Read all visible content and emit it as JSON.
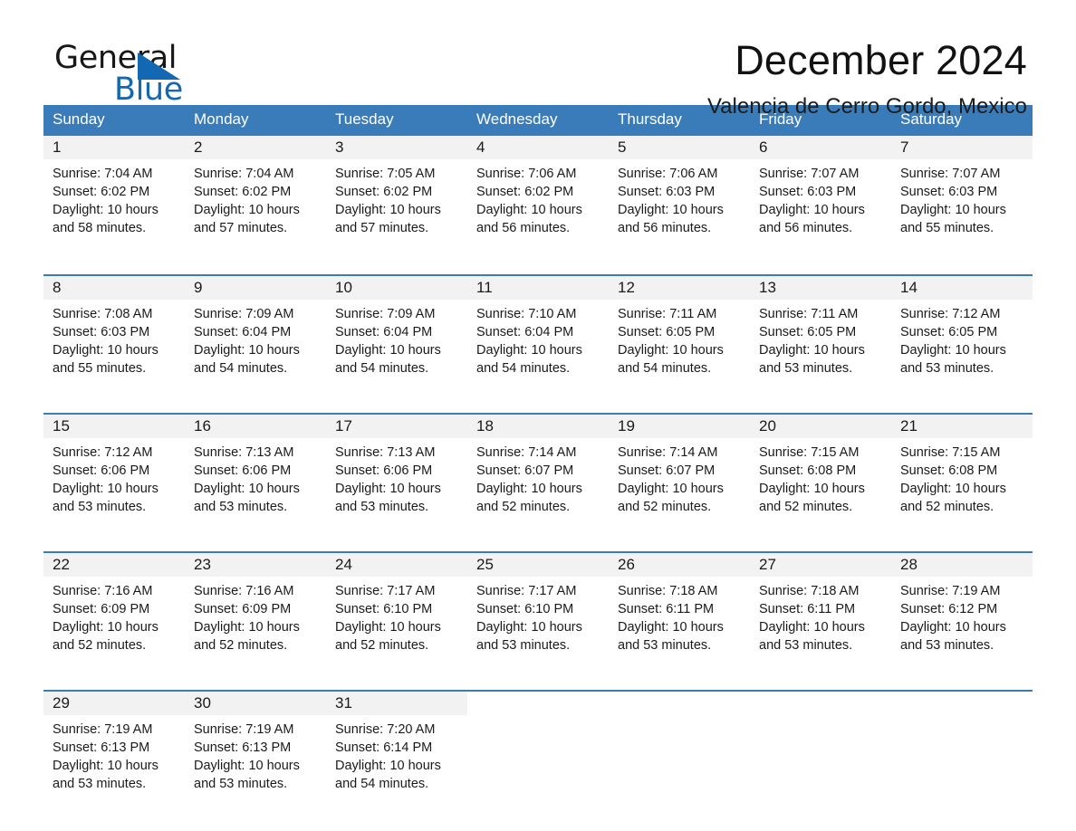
{
  "logo": {
    "word1": "General",
    "word2": "Blue",
    "triangle_color": "#1268b3"
  },
  "header": {
    "month_title": "December 2024",
    "location": "Valencia de Cerro Gordo, Mexico",
    "header_bg_color": "#3a7cba",
    "daynum_bg_color": "#f2f2f2"
  },
  "weekday_headers": [
    "Sunday",
    "Monday",
    "Tuesday",
    "Wednesday",
    "Thursday",
    "Friday",
    "Saturday"
  ],
  "weeks": [
    [
      {
        "day": "1",
        "sunrise": "Sunrise: 7:04 AM",
        "sunset": "Sunset: 6:02 PM",
        "daylight_1": "Daylight: 10 hours",
        "daylight_2": "and 58 minutes."
      },
      {
        "day": "2",
        "sunrise": "Sunrise: 7:04 AM",
        "sunset": "Sunset: 6:02 PM",
        "daylight_1": "Daylight: 10 hours",
        "daylight_2": "and 57 minutes."
      },
      {
        "day": "3",
        "sunrise": "Sunrise: 7:05 AM",
        "sunset": "Sunset: 6:02 PM",
        "daylight_1": "Daylight: 10 hours",
        "daylight_2": "and 57 minutes."
      },
      {
        "day": "4",
        "sunrise": "Sunrise: 7:06 AM",
        "sunset": "Sunset: 6:02 PM",
        "daylight_1": "Daylight: 10 hours",
        "daylight_2": "and 56 minutes."
      },
      {
        "day": "5",
        "sunrise": "Sunrise: 7:06 AM",
        "sunset": "Sunset: 6:03 PM",
        "daylight_1": "Daylight: 10 hours",
        "daylight_2": "and 56 minutes."
      },
      {
        "day": "6",
        "sunrise": "Sunrise: 7:07 AM",
        "sunset": "Sunset: 6:03 PM",
        "daylight_1": "Daylight: 10 hours",
        "daylight_2": "and 56 minutes."
      },
      {
        "day": "7",
        "sunrise": "Sunrise: 7:07 AM",
        "sunset": "Sunset: 6:03 PM",
        "daylight_1": "Daylight: 10 hours",
        "daylight_2": "and 55 minutes."
      }
    ],
    [
      {
        "day": "8",
        "sunrise": "Sunrise: 7:08 AM",
        "sunset": "Sunset: 6:03 PM",
        "daylight_1": "Daylight: 10 hours",
        "daylight_2": "and 55 minutes."
      },
      {
        "day": "9",
        "sunrise": "Sunrise: 7:09 AM",
        "sunset": "Sunset: 6:04 PM",
        "daylight_1": "Daylight: 10 hours",
        "daylight_2": "and 54 minutes."
      },
      {
        "day": "10",
        "sunrise": "Sunrise: 7:09 AM",
        "sunset": "Sunset: 6:04 PM",
        "daylight_1": "Daylight: 10 hours",
        "daylight_2": "and 54 minutes."
      },
      {
        "day": "11",
        "sunrise": "Sunrise: 7:10 AM",
        "sunset": "Sunset: 6:04 PM",
        "daylight_1": "Daylight: 10 hours",
        "daylight_2": "and 54 minutes."
      },
      {
        "day": "12",
        "sunrise": "Sunrise: 7:11 AM",
        "sunset": "Sunset: 6:05 PM",
        "daylight_1": "Daylight: 10 hours",
        "daylight_2": "and 54 minutes."
      },
      {
        "day": "13",
        "sunrise": "Sunrise: 7:11 AM",
        "sunset": "Sunset: 6:05 PM",
        "daylight_1": "Daylight: 10 hours",
        "daylight_2": "and 53 minutes."
      },
      {
        "day": "14",
        "sunrise": "Sunrise: 7:12 AM",
        "sunset": "Sunset: 6:05 PM",
        "daylight_1": "Daylight: 10 hours",
        "daylight_2": "and 53 minutes."
      }
    ],
    [
      {
        "day": "15",
        "sunrise": "Sunrise: 7:12 AM",
        "sunset": "Sunset: 6:06 PM",
        "daylight_1": "Daylight: 10 hours",
        "daylight_2": "and 53 minutes."
      },
      {
        "day": "16",
        "sunrise": "Sunrise: 7:13 AM",
        "sunset": "Sunset: 6:06 PM",
        "daylight_1": "Daylight: 10 hours",
        "daylight_2": "and 53 minutes."
      },
      {
        "day": "17",
        "sunrise": "Sunrise: 7:13 AM",
        "sunset": "Sunset: 6:06 PM",
        "daylight_1": "Daylight: 10 hours",
        "daylight_2": "and 53 minutes."
      },
      {
        "day": "18",
        "sunrise": "Sunrise: 7:14 AM",
        "sunset": "Sunset: 6:07 PM",
        "daylight_1": "Daylight: 10 hours",
        "daylight_2": "and 52 minutes."
      },
      {
        "day": "19",
        "sunrise": "Sunrise: 7:14 AM",
        "sunset": "Sunset: 6:07 PM",
        "daylight_1": "Daylight: 10 hours",
        "daylight_2": "and 52 minutes."
      },
      {
        "day": "20",
        "sunrise": "Sunrise: 7:15 AM",
        "sunset": "Sunset: 6:08 PM",
        "daylight_1": "Daylight: 10 hours",
        "daylight_2": "and 52 minutes."
      },
      {
        "day": "21",
        "sunrise": "Sunrise: 7:15 AM",
        "sunset": "Sunset: 6:08 PM",
        "daylight_1": "Daylight: 10 hours",
        "daylight_2": "and 52 minutes."
      }
    ],
    [
      {
        "day": "22",
        "sunrise": "Sunrise: 7:16 AM",
        "sunset": "Sunset: 6:09 PM",
        "daylight_1": "Daylight: 10 hours",
        "daylight_2": "and 52 minutes."
      },
      {
        "day": "23",
        "sunrise": "Sunrise: 7:16 AM",
        "sunset": "Sunset: 6:09 PM",
        "daylight_1": "Daylight: 10 hours",
        "daylight_2": "and 52 minutes."
      },
      {
        "day": "24",
        "sunrise": "Sunrise: 7:17 AM",
        "sunset": "Sunset: 6:10 PM",
        "daylight_1": "Daylight: 10 hours",
        "daylight_2": "and 52 minutes."
      },
      {
        "day": "25",
        "sunrise": "Sunrise: 7:17 AM",
        "sunset": "Sunset: 6:10 PM",
        "daylight_1": "Daylight: 10 hours",
        "daylight_2": "and 53 minutes."
      },
      {
        "day": "26",
        "sunrise": "Sunrise: 7:18 AM",
        "sunset": "Sunset: 6:11 PM",
        "daylight_1": "Daylight: 10 hours",
        "daylight_2": "and 53 minutes."
      },
      {
        "day": "27",
        "sunrise": "Sunrise: 7:18 AM",
        "sunset": "Sunset: 6:11 PM",
        "daylight_1": "Daylight: 10 hours",
        "daylight_2": "and 53 minutes."
      },
      {
        "day": "28",
        "sunrise": "Sunrise: 7:19 AM",
        "sunset": "Sunset: 6:12 PM",
        "daylight_1": "Daylight: 10 hours",
        "daylight_2": "and 53 minutes."
      }
    ],
    [
      {
        "day": "29",
        "sunrise": "Sunrise: 7:19 AM",
        "sunset": "Sunset: 6:13 PM",
        "daylight_1": "Daylight: 10 hours",
        "daylight_2": "and 53 minutes."
      },
      {
        "day": "30",
        "sunrise": "Sunrise: 7:19 AM",
        "sunset": "Sunset: 6:13 PM",
        "daylight_1": "Daylight: 10 hours",
        "daylight_2": "and 53 minutes."
      },
      {
        "day": "31",
        "sunrise": "Sunrise: 7:20 AM",
        "sunset": "Sunset: 6:14 PM",
        "daylight_1": "Daylight: 10 hours",
        "daylight_2": "and 54 minutes."
      },
      {
        "day": "",
        "sunrise": "",
        "sunset": "",
        "daylight_1": "",
        "daylight_2": ""
      },
      {
        "day": "",
        "sunrise": "",
        "sunset": "",
        "daylight_1": "",
        "daylight_2": ""
      },
      {
        "day": "",
        "sunrise": "",
        "sunset": "",
        "daylight_1": "",
        "daylight_2": ""
      },
      {
        "day": "",
        "sunrise": "",
        "sunset": "",
        "daylight_1": "",
        "daylight_2": ""
      }
    ]
  ]
}
